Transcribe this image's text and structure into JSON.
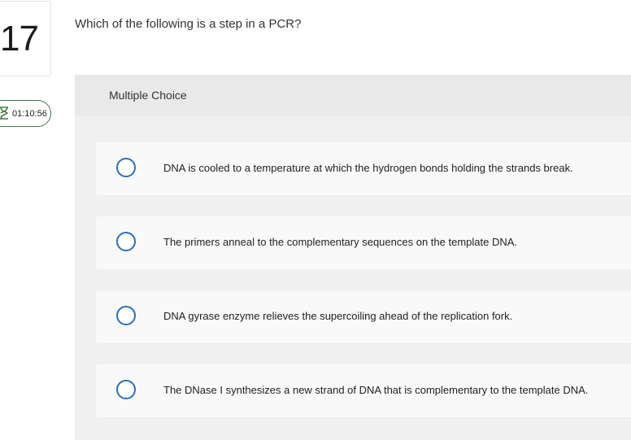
{
  "question": {
    "number": "17",
    "text": "Which of the following is a step in a PCR?"
  },
  "timer": {
    "icon": "hourglass-icon",
    "value": "01:10:56"
  },
  "answer_panel": {
    "type_label": "Multiple Choice",
    "options": [
      {
        "label": "DNA is cooled to a temperature at which the hydrogen bonds holding the strands break."
      },
      {
        "label": "The primers anneal to the complementary sequences on the template DNA."
      },
      {
        "label": "DNA gyrase enzyme relieves the supercoiling ahead of the replication fork."
      },
      {
        "label": "The DNase I synthesizes a new strand of DNA that is complementary to the template DNA."
      }
    ]
  },
  "colors": {
    "radio_border": "#2a6ebb",
    "timer_border": "#3a7a3a",
    "panel_bg": "#f0f0f0",
    "option_bg": "#f9f9f9"
  }
}
